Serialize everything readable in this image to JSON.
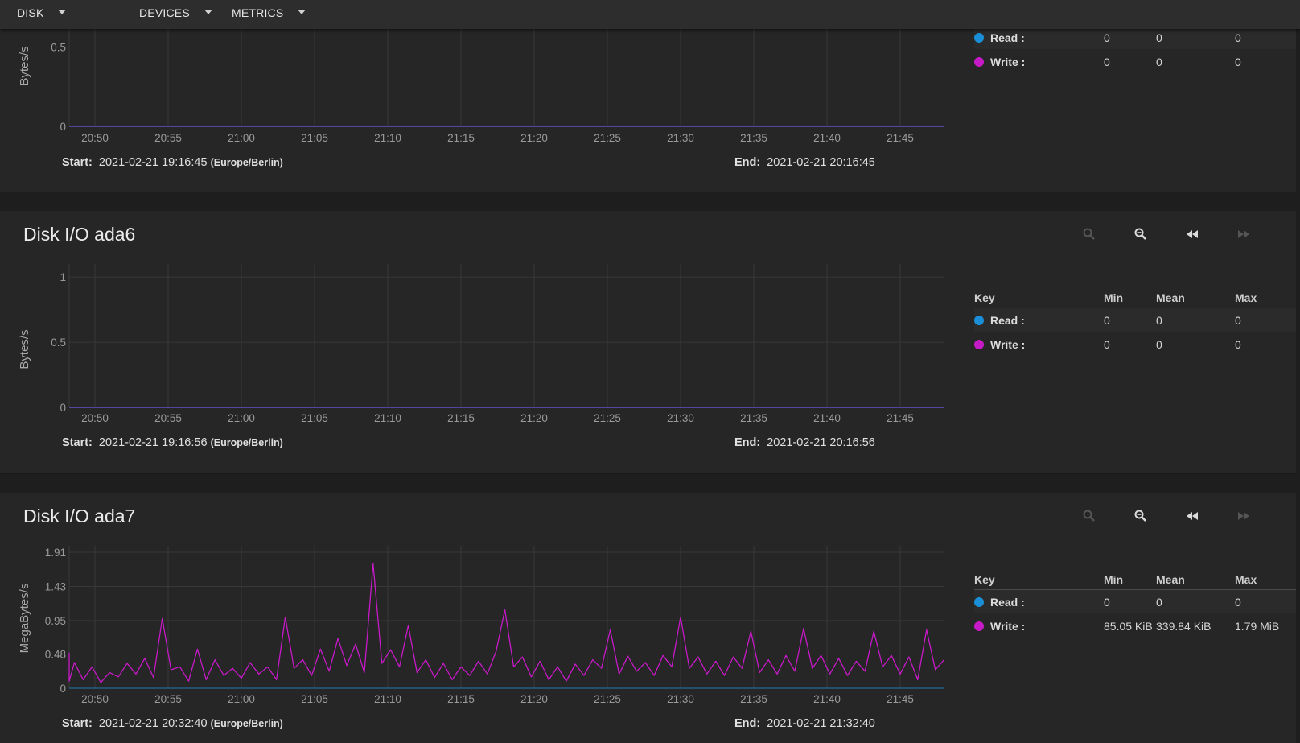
{
  "menus": {
    "disk": "DISK",
    "devices": "DEVICES",
    "metrics": "METRICS"
  },
  "colors": {
    "read": "#1a8fd8",
    "write": "#c61ac6",
    "grid": "#383838",
    "background": "#262626"
  },
  "legend_headers": {
    "key": "Key",
    "min": "Min",
    "mean": "Mean",
    "max": "Max"
  },
  "range_labels": {
    "start": "Start:",
    "end": "End:"
  },
  "panels": [
    {
      "title": "",
      "ylabel": "Bytes/s",
      "start": "2021-02-21 19:16:45",
      "timezone": "(Europe/Berlin)",
      "end": "2021-02-21 20:16:45",
      "legend": [
        {
          "key": "Read :",
          "min": "0",
          "mean": "0",
          "max": "0"
        },
        {
          "key": "Write :",
          "min": "0",
          "mean": "0",
          "max": "0"
        }
      ]
    },
    {
      "title": "Disk I/O ada6",
      "ylabel": "Bytes/s",
      "start": "2021-02-21 19:16:56",
      "timezone": "(Europe/Berlin)",
      "end": "2021-02-21 20:16:56",
      "legend": [
        {
          "key": "Read :",
          "min": "0",
          "mean": "0",
          "max": "0"
        },
        {
          "key": "Write :",
          "min": "0",
          "mean": "0",
          "max": "0"
        }
      ]
    },
    {
      "title": "Disk I/O ada7",
      "ylabel": "MegaBytes/s",
      "start": "2021-02-21 20:32:40",
      "timezone": "(Europe/Berlin)",
      "end": "2021-02-21 21:32:40",
      "legend": [
        {
          "key": "Read :",
          "min": "0",
          "mean": "0",
          "max": "0"
        },
        {
          "key": "Write :",
          "min": "85.05 KiB",
          "mean": "339.84 KiB",
          "max": "1.79 MiB"
        }
      ]
    }
  ],
  "chart_data": [
    {
      "type": "line",
      "ylabel": "Bytes/s",
      "x_ticks": [
        "20:50",
        "20:55",
        "21:00",
        "21:05",
        "21:10",
        "21:15",
        "21:20",
        "21:25",
        "21:30",
        "21:35",
        "21:40",
        "21:45"
      ],
      "y_ticks": [
        "0.5",
        "0"
      ],
      "y_tick_values": [
        0.5,
        0
      ],
      "ylim": [
        0,
        1
      ],
      "xlim": [
        20.79,
        21.8
      ],
      "grid": true,
      "series": [
        {
          "name": "Read",
          "values": [
            [
              20.79,
              0
            ],
            [
              21.8,
              0
            ]
          ]
        },
        {
          "name": "Write",
          "values": [
            [
              20.79,
              0
            ],
            [
              21.8,
              0
            ]
          ]
        }
      ]
    },
    {
      "type": "line",
      "ylabel": "Bytes/s",
      "x_ticks": [
        "20:50",
        "20:55",
        "21:00",
        "21:05",
        "21:10",
        "21:15",
        "21:20",
        "21:25",
        "21:30",
        "21:35",
        "21:40",
        "21:45"
      ],
      "y_ticks": [
        "1",
        "0.5",
        "0"
      ],
      "y_tick_values": [
        1,
        0.5,
        0
      ],
      "ylim": [
        0,
        1.1
      ],
      "xlim": [
        20.79,
        21.8
      ],
      "grid": true,
      "series": [
        {
          "name": "Read",
          "values": [
            [
              20.79,
              0
            ],
            [
              21.8,
              0
            ]
          ]
        },
        {
          "name": "Write",
          "values": [
            [
              20.79,
              0
            ],
            [
              21.8,
              0
            ]
          ]
        }
      ]
    },
    {
      "type": "line",
      "ylabel": "MegaBytes/s",
      "x_ticks": [
        "20:50",
        "20:55",
        "21:00",
        "21:05",
        "21:10",
        "21:15",
        "21:20",
        "21:25",
        "21:30",
        "21:35",
        "21:40",
        "21:45"
      ],
      "y_ticks": [
        "1.91",
        "1.43",
        "0.95",
        "0.48",
        "0"
      ],
      "y_tick_values": [
        1.91,
        1.43,
        0.95,
        0.48,
        0
      ],
      "ylim": [
        0,
        2.0
      ],
      "xlim": [
        20.79,
        21.8
      ],
      "grid": true,
      "series": [
        {
          "name": "Read",
          "values": [
            [
              20.79,
              0
            ],
            [
              21.8,
              0
            ]
          ]
        },
        {
          "name": "Write",
          "values": [
            [
              20.79,
              0.5
            ],
            [
              20.8,
              0.1
            ],
            [
              20.81,
              0.36
            ],
            [
              20.82,
              0.12
            ],
            [
              20.83,
              0.3
            ],
            [
              20.84,
              0.08
            ],
            [
              20.85,
              0.22
            ],
            [
              20.86,
              0.16
            ],
            [
              20.87,
              0.35
            ],
            [
              20.88,
              0.2
            ],
            [
              20.89,
              0.42
            ],
            [
              20.9,
              0.15
            ],
            [
              20.91,
              0.98
            ],
            [
              20.92,
              0.26
            ],
            [
              20.93,
              0.3
            ],
            [
              20.94,
              0.1
            ],
            [
              20.95,
              0.55
            ],
            [
              20.96,
              0.12
            ],
            [
              20.97,
              0.4
            ],
            [
              20.98,
              0.18
            ],
            [
              20.99,
              0.28
            ],
            [
              21.0,
              0.14
            ],
            [
              21.01,
              0.36
            ],
            [
              21.02,
              0.2
            ],
            [
              21.03,
              0.3
            ],
            [
              21.04,
              0.12
            ],
            [
              21.05,
              1.0
            ],
            [
              21.06,
              0.28
            ],
            [
              21.07,
              0.4
            ],
            [
              21.08,
              0.18
            ],
            [
              21.09,
              0.55
            ],
            [
              21.1,
              0.24
            ],
            [
              21.11,
              0.7
            ],
            [
              21.12,
              0.32
            ],
            [
              21.13,
              0.62
            ],
            [
              21.14,
              0.22
            ],
            [
              21.15,
              1.75
            ],
            [
              21.16,
              0.35
            ],
            [
              21.17,
              0.54
            ],
            [
              21.18,
              0.3
            ],
            [
              21.19,
              0.88
            ],
            [
              21.2,
              0.22
            ],
            [
              21.21,
              0.4
            ],
            [
              21.22,
              0.15
            ],
            [
              21.23,
              0.35
            ],
            [
              21.24,
              0.12
            ],
            [
              21.25,
              0.3
            ],
            [
              21.26,
              0.18
            ],
            [
              21.27,
              0.38
            ],
            [
              21.28,
              0.2
            ],
            [
              21.29,
              0.52
            ],
            [
              21.3,
              1.1
            ],
            [
              21.31,
              0.3
            ],
            [
              21.32,
              0.44
            ],
            [
              21.33,
              0.16
            ],
            [
              21.34,
              0.38
            ],
            [
              21.35,
              0.12
            ],
            [
              21.36,
              0.3
            ],
            [
              21.37,
              0.1
            ],
            [
              21.38,
              0.34
            ],
            [
              21.39,
              0.18
            ],
            [
              21.4,
              0.4
            ],
            [
              21.41,
              0.28
            ],
            [
              21.42,
              0.82
            ],
            [
              21.43,
              0.2
            ],
            [
              21.44,
              0.45
            ],
            [
              21.45,
              0.24
            ],
            [
              21.46,
              0.36
            ],
            [
              21.47,
              0.18
            ],
            [
              21.48,
              0.46
            ],
            [
              21.49,
              0.3
            ],
            [
              21.5,
              1.0
            ],
            [
              21.51,
              0.28
            ],
            [
              21.52,
              0.44
            ],
            [
              21.53,
              0.2
            ],
            [
              21.54,
              0.38
            ],
            [
              21.55,
              0.18
            ],
            [
              21.56,
              0.44
            ],
            [
              21.57,
              0.28
            ],
            [
              21.58,
              0.8
            ],
            [
              21.59,
              0.22
            ],
            [
              21.6,
              0.4
            ],
            [
              21.61,
              0.2
            ],
            [
              21.62,
              0.46
            ],
            [
              21.63,
              0.24
            ],
            [
              21.64,
              0.84
            ],
            [
              21.65,
              0.28
            ],
            [
              21.66,
              0.46
            ],
            [
              21.67,
              0.2
            ],
            [
              21.68,
              0.42
            ],
            [
              21.69,
              0.18
            ],
            [
              21.7,
              0.38
            ],
            [
              21.71,
              0.24
            ],
            [
              21.72,
              0.8
            ],
            [
              21.73,
              0.3
            ],
            [
              21.74,
              0.46
            ],
            [
              21.75,
              0.2
            ],
            [
              21.76,
              0.44
            ],
            [
              21.77,
              0.12
            ],
            [
              21.78,
              0.82
            ],
            [
              21.79,
              0.26
            ],
            [
              21.8,
              0.4
            ]
          ]
        }
      ]
    }
  ]
}
